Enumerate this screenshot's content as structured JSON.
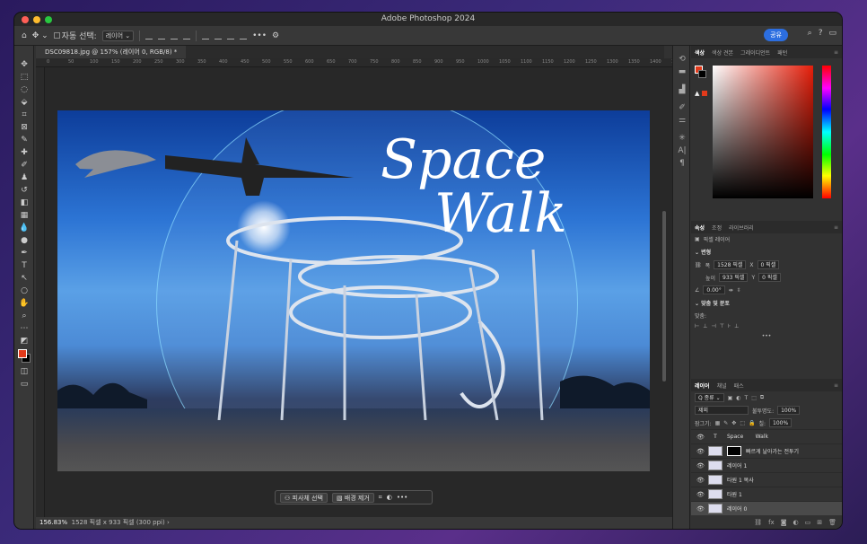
{
  "window": {
    "title": "Adobe Photoshop 2024",
    "traffic_colors": [
      "#ff5f57",
      "#febc2e",
      "#28c840"
    ]
  },
  "options_bar": {
    "auto_select_label": "자동 선택:",
    "auto_select_value": "레이어",
    "more": "•••",
    "share_label": "공유"
  },
  "document_tab": {
    "label": "DSC09818.jpg @ 157% (레이어 0, RGB/8) *"
  },
  "ruler": {
    "ticks": [
      "0",
      "50",
      "100",
      "150",
      "200",
      "250",
      "300",
      "350",
      "400",
      "450",
      "500",
      "550",
      "600",
      "650",
      "700",
      "750",
      "800",
      "850",
      "900",
      "950",
      "1000",
      "1050",
      "1100",
      "1150",
      "1200",
      "1250",
      "1300",
      "1350",
      "1400",
      "1450",
      "1500"
    ]
  },
  "canvas": {
    "title_line1": "Space",
    "title_line2": "Walk"
  },
  "contextual_bar": {
    "select_subject": "피사체 선택",
    "remove_bg": "배경 제거",
    "more": "•••"
  },
  "status_bar": {
    "zoom": "156.83%",
    "info": "1528 픽셀 x 933 픽셀 (300 ppi)"
  },
  "color_panel": {
    "tabs": [
      "색상",
      "색상 견본",
      "그레이디언트",
      "패턴"
    ],
    "fg_color": "#e23a1b",
    "bg_color": "#000000"
  },
  "properties_panel": {
    "tabs": [
      "속성",
      "조정",
      "라이브러리"
    ],
    "layer_type": "픽셀 레이어",
    "transform_header": "변형",
    "width_label": "폭",
    "width_value": "1528 픽셀",
    "height_label": "높이",
    "height_value": "933 픽셀",
    "x_label": "X",
    "x_value": "0 픽셀",
    "y_label": "Y",
    "y_value": "0 픽셀",
    "angle_value": "0.00°",
    "align_header": "맞춤 및 분포",
    "align_sub": "맞춤:",
    "more": "•••"
  },
  "layers_panel": {
    "tabs": [
      "레이어",
      "채널",
      "패스"
    ],
    "filter_label": "Q 종류",
    "blend_mode": "제외",
    "opacity_label": "불투명도:",
    "opacity_value": "100%",
    "lock_label": "잠그기:",
    "fill_label": "칠:",
    "fill_value": "100%",
    "layers": [
      {
        "name": "Space       Walk",
        "type": "text"
      },
      {
        "name": "빠르게 날아가는 전투기",
        "type": "mask"
      },
      {
        "name": "레이어 1",
        "type": "pixel"
      },
      {
        "name": "타원 1 복사",
        "type": "shape"
      },
      {
        "name": "타원 1",
        "type": "shape"
      },
      {
        "name": "레이어 0",
        "type": "pixel",
        "selected": true
      }
    ]
  }
}
